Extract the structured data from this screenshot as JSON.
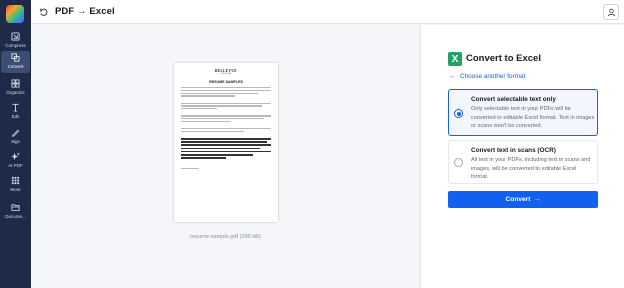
{
  "rail": {
    "items": [
      {
        "label": "Compress",
        "icon": "compress-icon"
      },
      {
        "label": "Convert",
        "icon": "convert-icon",
        "active": true
      },
      {
        "label": "Organize",
        "icon": "organize-icon"
      },
      {
        "label": "Edit",
        "icon": "edit-icon"
      },
      {
        "label": "Sign",
        "icon": "sign-icon"
      },
      {
        "label": "AI PDF",
        "icon": "ai-sparkle-icon"
      },
      {
        "label": "More",
        "icon": "more-grid-icon"
      },
      {
        "label": "Docume...",
        "icon": "documents-icon"
      }
    ]
  },
  "header": {
    "title": "PDF → Excel"
  },
  "preview": {
    "doc_brand": "BELLEVUE",
    "doc_sub": "COLLEGE",
    "doc_heading": "RESUME SAMPLES",
    "filename": "resume-sample.pdf (295 kB)"
  },
  "panel": {
    "title": "Convert to Excel",
    "choose_format": "Choose another format",
    "options": [
      {
        "title": "Convert selectable text only",
        "description": "Only selectable text in your PDFs will be converted to editable Excel format. Text in images or scans won't be converted.",
        "selected": true
      },
      {
        "title": "Convert text in scans (OCR)",
        "description": "All text in your PDFs, including text in scans and images, will be converted to editable Excel format.",
        "selected": false
      }
    ],
    "convert_label": "Convert"
  },
  "colors": {
    "rail_bg": "#1e2a47",
    "accent": "#1061f2",
    "excel_green": "#21a366"
  }
}
